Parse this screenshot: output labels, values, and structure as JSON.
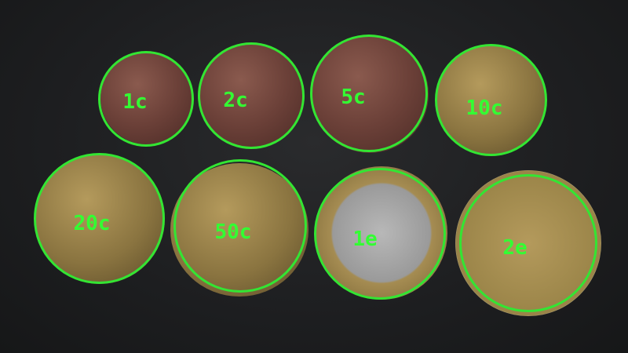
{
  "annotation_color": "#33e533",
  "coins": [
    {
      "label": "1c"
    },
    {
      "label": "2c"
    },
    {
      "label": "5c"
    },
    {
      "label": "10c"
    },
    {
      "label": "20c"
    },
    {
      "label": "50c"
    },
    {
      "label": "1e"
    },
    {
      "label": "2e"
    }
  ]
}
